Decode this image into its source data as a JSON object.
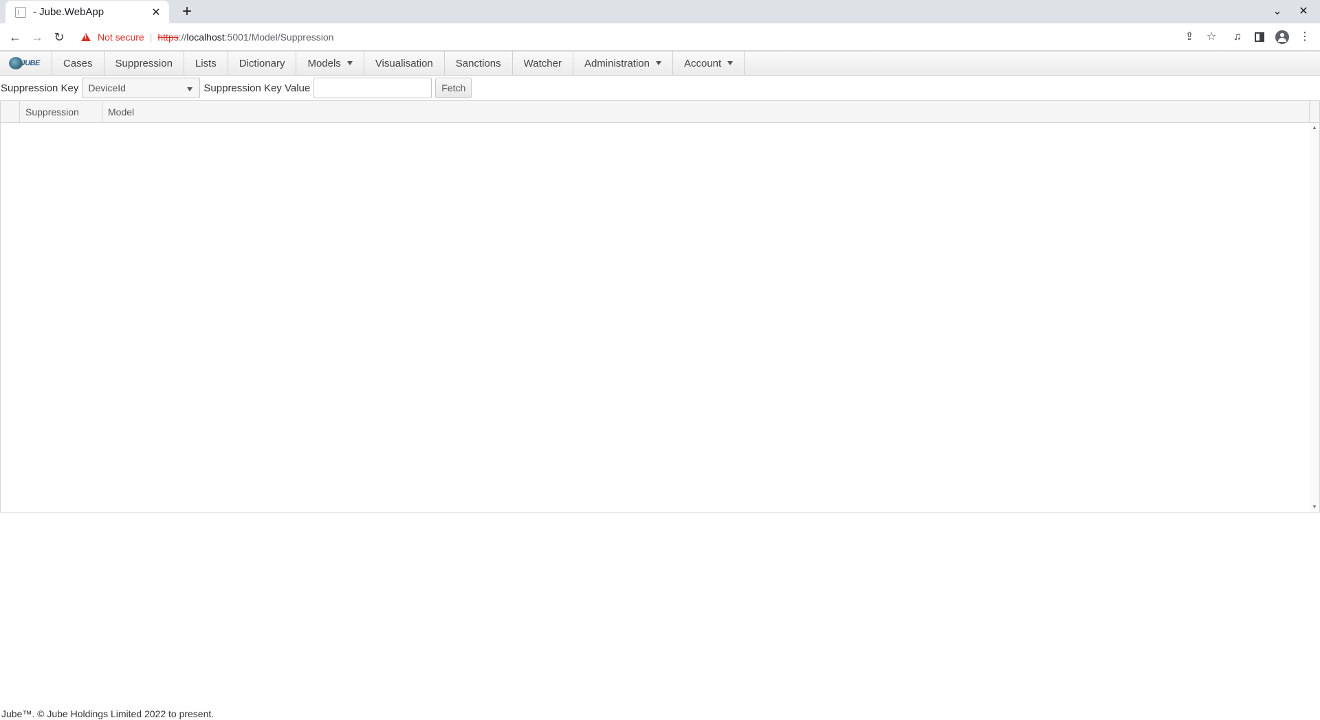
{
  "browser": {
    "tab_title": "- Jube.WebApp",
    "tab_close": "✕",
    "new_tab": "+",
    "security_label": "Not secure",
    "url_scheme": "https",
    "url_sep": "://",
    "url_host": "localhost",
    "url_path": ":5001/Model/Suppression",
    "icons": [
      "back-arrow-icon",
      "forward-arrow-icon",
      "reload-icon",
      "warning-icon",
      "share-icon",
      "star-icon",
      "media-icon",
      "side-panel-icon",
      "profile-icon",
      "kebab-menu-icon"
    ]
  },
  "menubar": {
    "logo_text": "JUBE",
    "items": [
      {
        "label": "Cases"
      },
      {
        "label": "Suppression"
      },
      {
        "label": "Lists"
      },
      {
        "label": "Dictionary"
      },
      {
        "label": "Models",
        "dropdown": true
      },
      {
        "label": "Visualisation"
      },
      {
        "label": "Sanctions"
      },
      {
        "label": "Watcher"
      },
      {
        "label": "Administration",
        "dropdown": true
      },
      {
        "label": "Account",
        "dropdown": true
      }
    ]
  },
  "filter": {
    "key_label": "Suppression Key",
    "key_value": "DeviceId",
    "value_label": "Suppression Key Value",
    "value_input": "",
    "fetch_label": "Fetch"
  },
  "grid": {
    "columns": [
      "",
      "Suppression",
      "Model"
    ],
    "rows": []
  },
  "footer": {
    "text": "Jube™. © Jube Holdings Limited 2022 to present."
  }
}
